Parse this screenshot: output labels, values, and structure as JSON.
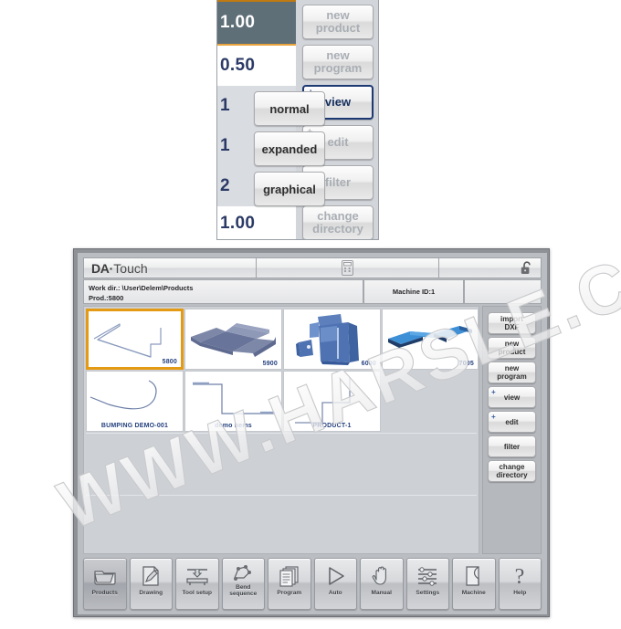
{
  "top_panel": {
    "values": [
      {
        "text": "1.00",
        "state": "selected"
      },
      {
        "text": "0.50",
        "state": "normal"
      },
      {
        "text": "1",
        "state": "grey"
      },
      {
        "text": "1",
        "state": "grey"
      },
      {
        "text": "2",
        "state": "grey"
      },
      {
        "text": "1.00",
        "state": "normal"
      }
    ],
    "mode_buttons": [
      {
        "label": "normal",
        "enabled": true
      },
      {
        "label": "expanded",
        "enabled": true
      },
      {
        "label": "graphical",
        "enabled": true
      }
    ],
    "action_buttons": [
      {
        "label": "new\nproduct",
        "line1": "new",
        "line2": "product",
        "enabled": false,
        "plus": false,
        "focus": false
      },
      {
        "label": "new\nprogram",
        "line1": "new",
        "line2": "program",
        "enabled": false,
        "plus": false,
        "focus": false
      },
      {
        "label": "view",
        "line1": "view",
        "line2": "",
        "enabled": true,
        "plus": true,
        "focus": true
      },
      {
        "label": "edit",
        "line1": "edit",
        "line2": "",
        "enabled": false,
        "plus": true,
        "focus": false
      },
      {
        "label": "filter",
        "line1": "filter",
        "line2": "",
        "enabled": false,
        "plus": false,
        "focus": false
      },
      {
        "label": "change directory",
        "line1": "change",
        "line2": "directory",
        "enabled": false,
        "plus": false,
        "focus": false
      }
    ]
  },
  "window": {
    "titlebar": {
      "brand_bold": "DA",
      "brand_dot": "·",
      "brand_rest": "Touch",
      "center_icon": "numeric-keypad-icon",
      "right_icon": "unlocked-padlock-icon"
    },
    "infobar": {
      "work_dir_label": "Work dir.: \\User\\Delem\\Products",
      "product_label": "Prod.:5800",
      "machine_id": "Machine ID:1"
    },
    "products": [
      {
        "name": "5800",
        "label_pos": "corner",
        "selected": true,
        "kind": "profile-arrow",
        "row": 0,
        "col": 0
      },
      {
        "name": "5900",
        "label_pos": "corner",
        "selected": false,
        "kind": "render-tray",
        "row": 0,
        "col": 1
      },
      {
        "name": "6000",
        "label_pos": "corner",
        "selected": false,
        "kind": "render-cabinet",
        "row": 0,
        "col": 2
      },
      {
        "name": "7005",
        "label_pos": "corner",
        "selected": false,
        "kind": "render-panel",
        "row": 0,
        "col": 3
      },
      {
        "name": "BUMPING DEMO-001",
        "label_pos": "bottom",
        "selected": false,
        "kind": "profile-curve",
        "row": 1,
        "col": 0
      },
      {
        "name": "demo hems",
        "label_pos": "bottom",
        "selected": false,
        "kind": "profile-hem",
        "row": 1,
        "col": 1
      },
      {
        "name": "PRODUCT-1",
        "label_pos": "bottom",
        "selected": false,
        "kind": "profile-step",
        "row": 1,
        "col": 2
      }
    ],
    "side_buttons": [
      {
        "line1": "import",
        "line2": "DXF",
        "plus": false
      },
      {
        "line1": "new",
        "line2": "product",
        "plus": false
      },
      {
        "line1": "new",
        "line2": "program",
        "plus": false
      },
      {
        "line1": "view",
        "line2": "",
        "plus": true
      },
      {
        "line1": "edit",
        "line2": "",
        "plus": true
      },
      {
        "line1": "filter",
        "line2": "",
        "plus": false
      },
      {
        "line1": "change",
        "line2": "directory",
        "plus": false
      }
    ],
    "bottom_nav": [
      {
        "label": "Products",
        "icon": "folder-icon",
        "active": true
      },
      {
        "label": "Drawing",
        "icon": "pencil-page-icon",
        "active": false
      },
      {
        "label": "Tool setup",
        "icon": "press-tool-icon",
        "active": false
      },
      {
        "label": "Bend sequence",
        "icon": "bend-sequence-icon",
        "active": false
      },
      {
        "label": "Program",
        "icon": "pages-stack-icon",
        "active": false
      },
      {
        "label": "Auto",
        "icon": "play-triangle-icon",
        "active": false
      },
      {
        "label": "Manual",
        "icon": "hand-icon",
        "active": false
      },
      {
        "label": "Settings",
        "icon": "sliders-list-icon",
        "active": false
      },
      {
        "label": "Machine",
        "icon": "machine-page-icon",
        "active": false
      },
      {
        "label": "Help",
        "icon": "question-mark-icon",
        "active": false
      }
    ]
  },
  "watermark": {
    "text": "WWW.HARSLE.COM"
  },
  "colors": {
    "accent_orange": "#e59a14",
    "focus_blue": "#1d3a73",
    "label_blue": "#24407e",
    "selected_row_bg": "#5f6f78"
  }
}
